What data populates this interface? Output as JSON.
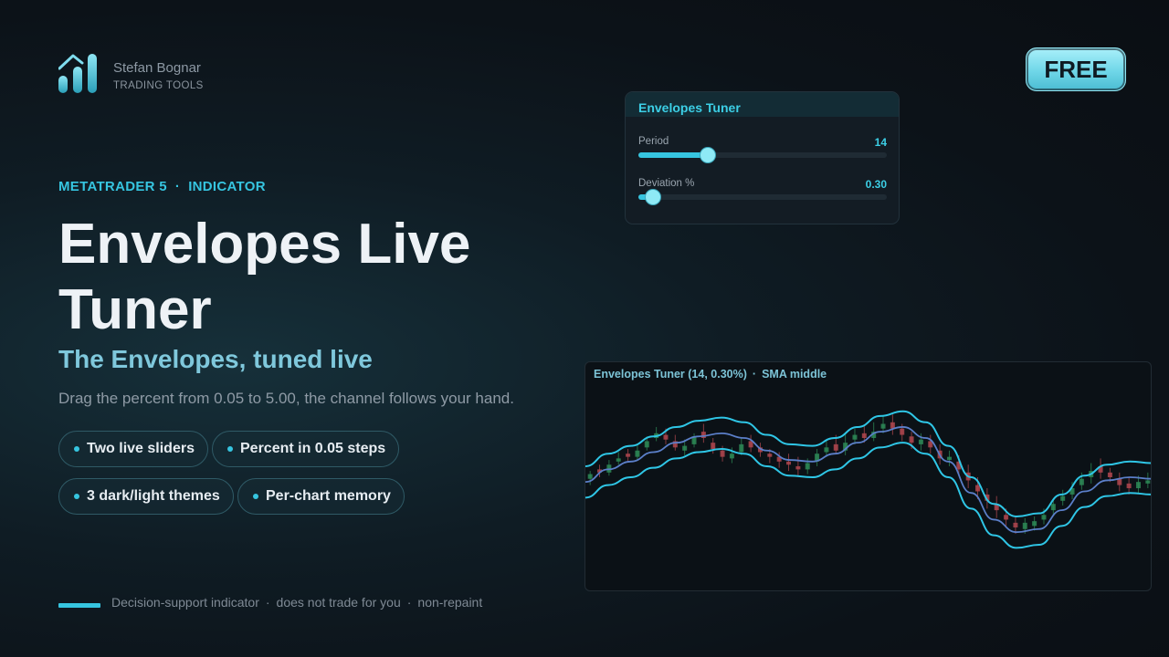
{
  "brand": {
    "name": "Stefan Bognar",
    "subtitle": "TRADING TOOLS"
  },
  "badge": {
    "label": "FREE"
  },
  "hero": {
    "eyebrow_platform": "METATRADER 5",
    "eyebrow_separator": "·",
    "eyebrow_type": "INDICATOR",
    "title": "Envelopes Live Tuner",
    "subtitle": "The Envelopes, tuned live",
    "description": "Drag the percent from 0.05 to 5.00, the channel follows your hand."
  },
  "features": [
    {
      "label": "Two live sliders"
    },
    {
      "label": "Percent in 0.05 steps"
    },
    {
      "label": "3 dark/light themes"
    },
    {
      "label": "Per-chart memory"
    }
  ],
  "footer": {
    "items": [
      "Decision-support indicator",
      "does not trade for you",
      "non-repaint"
    ],
    "separator": "·"
  },
  "tuner_panel": {
    "title": "Envelopes Tuner",
    "sliders": [
      {
        "label": "Period",
        "value": "14",
        "fraction": 0.28
      },
      {
        "label": "Deviation %",
        "value": "0.30",
        "fraction": 0.06
      }
    ]
  },
  "chart_caption": {
    "indicator": "Envelopes Tuner (14, 0.30%)",
    "separator": "·",
    "mode": "SMA middle"
  },
  "colors": {
    "accent": "#36c5e0",
    "band_outer": "#2fc6e6",
    "band_middle": "#5b7fc9",
    "candle_up": "#2e8b57",
    "candle_down": "#b0474f"
  },
  "chart_data": {
    "type": "line",
    "series": [
      {
        "values": [
          42,
          50,
          55,
          61,
          67,
          71,
          73,
          70,
          62,
          56,
          55,
          60,
          67,
          74,
          77,
          70,
          55,
          35,
          18,
          10,
          12,
          24,
          36,
          43,
          45,
          44
        ]
      },
      {
        "values": [
          52,
          60,
          65,
          71,
          77,
          81,
          83,
          80,
          72,
          66,
          65,
          70,
          77,
          84,
          87,
          80,
          65,
          45,
          28,
          20,
          22,
          34,
          46,
          53,
          55,
          54
        ]
      },
      {
        "values": [
          32,
          40,
          45,
          51,
          57,
          61,
          63,
          60,
          52,
          46,
          45,
          50,
          57,
          64,
          67,
          60,
          45,
          25,
          8,
          0,
          2,
          14,
          26,
          33,
          35,
          34
        ]
      }
    ],
    "ylim": [
      -5,
      95
    ],
    "candles": [
      {
        "o": 44,
        "c": 47,
        "h": 49,
        "l": 40,
        "up": true
      },
      {
        "o": 50,
        "c": 48,
        "h": 53,
        "l": 45,
        "up": false
      },
      {
        "o": 48,
        "c": 53,
        "h": 56,
        "l": 46,
        "up": true
      },
      {
        "o": 55,
        "c": 57,
        "h": 61,
        "l": 53,
        "up": true
      },
      {
        "o": 60,
        "c": 58,
        "h": 63,
        "l": 55,
        "up": false
      },
      {
        "o": 58,
        "c": 62,
        "h": 66,
        "l": 56,
        "up": true
      },
      {
        "o": 64,
        "c": 68,
        "h": 71,
        "l": 62,
        "up": true
      },
      {
        "o": 70,
        "c": 73,
        "h": 77,
        "l": 68,
        "up": true
      },
      {
        "o": 72,
        "c": 69,
        "h": 76,
        "l": 66,
        "up": false
      },
      {
        "o": 68,
        "c": 64,
        "h": 72,
        "l": 62,
        "up": false
      },
      {
        "o": 62,
        "c": 65,
        "h": 69,
        "l": 59,
        "up": true
      },
      {
        "o": 66,
        "c": 71,
        "h": 73,
        "l": 64,
        "up": true
      },
      {
        "o": 74,
        "c": 70,
        "h": 79,
        "l": 67,
        "up": false
      },
      {
        "o": 67,
        "c": 63,
        "h": 70,
        "l": 60,
        "up": false
      },
      {
        "o": 62,
        "c": 58,
        "h": 65,
        "l": 55,
        "up": false
      },
      {
        "o": 57,
        "c": 60,
        "h": 64,
        "l": 54,
        "up": true
      },
      {
        "o": 61,
        "c": 66,
        "h": 70,
        "l": 59,
        "up": true
      },
      {
        "o": 68,
        "c": 64,
        "h": 72,
        "l": 61,
        "up": false
      },
      {
        "o": 64,
        "c": 61,
        "h": 67,
        "l": 58,
        "up": false
      },
      {
        "o": 60,
        "c": 58,
        "h": 63,
        "l": 54,
        "up": false
      },
      {
        "o": 58,
        "c": 55,
        "h": 61,
        "l": 51,
        "up": false
      },
      {
        "o": 55,
        "c": 53,
        "h": 60,
        "l": 49,
        "up": false
      },
      {
        "o": 52,
        "c": 50,
        "h": 58,
        "l": 46,
        "up": false
      },
      {
        "o": 50,
        "c": 54,
        "h": 57,
        "l": 47,
        "up": true
      },
      {
        "o": 55,
        "c": 60,
        "h": 63,
        "l": 52,
        "up": true
      },
      {
        "o": 61,
        "c": 64,
        "h": 68,
        "l": 58,
        "up": true
      },
      {
        "o": 66,
        "c": 62,
        "h": 72,
        "l": 60,
        "up": false
      },
      {
        "o": 62,
        "c": 67,
        "h": 73,
        "l": 59,
        "up": true
      },
      {
        "o": 69,
        "c": 72,
        "h": 76,
        "l": 66,
        "up": true
      },
      {
        "o": 73,
        "c": 70,
        "h": 78,
        "l": 67,
        "up": false
      },
      {
        "o": 70,
        "c": 74,
        "h": 80,
        "l": 68,
        "up": true
      },
      {
        "o": 76,
        "c": 79,
        "h": 84,
        "l": 73,
        "up": true
      },
      {
        "o": 80,
        "c": 76,
        "h": 85,
        "l": 72,
        "up": false
      },
      {
        "o": 76,
        "c": 72,
        "h": 79,
        "l": 68,
        "up": false
      },
      {
        "o": 71,
        "c": 67,
        "h": 74,
        "l": 63,
        "up": false
      },
      {
        "o": 66,
        "c": 69,
        "h": 73,
        "l": 62,
        "up": true
      },
      {
        "o": 68,
        "c": 64,
        "h": 72,
        "l": 60,
        "up": false
      },
      {
        "o": 62,
        "c": 57,
        "h": 66,
        "l": 53,
        "up": false
      },
      {
        "o": 56,
        "c": 58,
        "h": 62,
        "l": 52,
        "up": true
      },
      {
        "o": 55,
        "c": 50,
        "h": 59,
        "l": 46,
        "up": false
      },
      {
        "o": 48,
        "c": 43,
        "h": 53,
        "l": 38,
        "up": false
      },
      {
        "o": 40,
        "c": 36,
        "h": 45,
        "l": 31,
        "up": false
      },
      {
        "o": 34,
        "c": 30,
        "h": 38,
        "l": 25,
        "up": false
      },
      {
        "o": 28,
        "c": 24,
        "h": 33,
        "l": 19,
        "up": false
      },
      {
        "o": 21,
        "c": 18,
        "h": 25,
        "l": 14,
        "up": false
      },
      {
        "o": 16,
        "c": 13,
        "h": 20,
        "l": 9,
        "up": false
      },
      {
        "o": 12,
        "c": 16,
        "h": 19,
        "l": 9,
        "up": true
      },
      {
        "o": 14,
        "c": 17,
        "h": 20,
        "l": 11,
        "up": true
      },
      {
        "o": 18,
        "c": 21,
        "h": 25,
        "l": 15,
        "up": true
      },
      {
        "o": 24,
        "c": 28,
        "h": 31,
        "l": 21,
        "up": true
      },
      {
        "o": 30,
        "c": 33,
        "h": 37,
        "l": 27,
        "up": true
      },
      {
        "o": 34,
        "c": 38,
        "h": 42,
        "l": 31,
        "up": true
      },
      {
        "o": 40,
        "c": 44,
        "h": 48,
        "l": 37,
        "up": true
      },
      {
        "o": 45,
        "c": 49,
        "h": 54,
        "l": 41,
        "up": true
      },
      {
        "o": 52,
        "c": 48,
        "h": 57,
        "l": 44,
        "up": false
      },
      {
        "o": 48,
        "c": 45,
        "h": 51,
        "l": 42,
        "up": false
      },
      {
        "o": 44,
        "c": 40,
        "h": 48,
        "l": 36,
        "up": false
      },
      {
        "o": 41,
        "c": 38,
        "h": 45,
        "l": 34,
        "up": false
      },
      {
        "o": 38,
        "c": 42,
        "h": 46,
        "l": 35,
        "up": true
      },
      {
        "o": 41,
        "c": 43,
        "h": 48,
        "l": 38,
        "up": true
      }
    ]
  }
}
